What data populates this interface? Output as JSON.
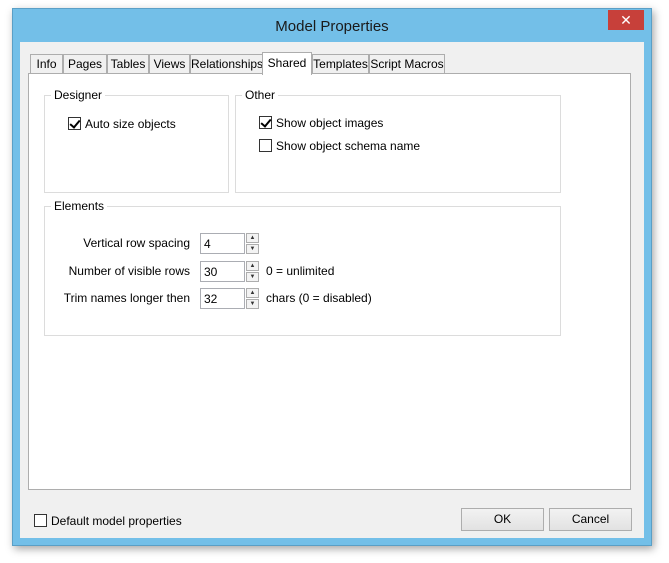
{
  "window": {
    "title": "Model Properties",
    "close_glyph": "✕"
  },
  "tabs": [
    {
      "label": "Info"
    },
    {
      "label": "Pages"
    },
    {
      "label": "Tables"
    },
    {
      "label": "Views"
    },
    {
      "label": "Relationships"
    },
    {
      "label": "Shared",
      "active": true
    },
    {
      "label": "Templates"
    },
    {
      "label": "Script Macros"
    }
  ],
  "designer": {
    "title": "Designer",
    "auto_size": {
      "label": "Auto size objects",
      "checked": true
    }
  },
  "other": {
    "title": "Other",
    "show_images": {
      "label": "Show object images",
      "checked": true
    },
    "show_schema": {
      "label": "Show object schema name",
      "checked": false
    }
  },
  "elements": {
    "title": "Elements",
    "row_spacing": {
      "label": "Vertical row spacing",
      "value": "4"
    },
    "visible_rows": {
      "label": "Number of visible rows",
      "value": "30",
      "hint": "0 = unlimited"
    },
    "trim_names": {
      "label": "Trim names longer then",
      "value": "32",
      "hint": "chars (0 = disabled)"
    }
  },
  "footer": {
    "default_props": {
      "label": "Default model properties",
      "checked": false
    },
    "ok_label": "OK",
    "cancel_label": "Cancel"
  },
  "icons": {
    "spin_up": "▲",
    "spin_down": "▼"
  }
}
